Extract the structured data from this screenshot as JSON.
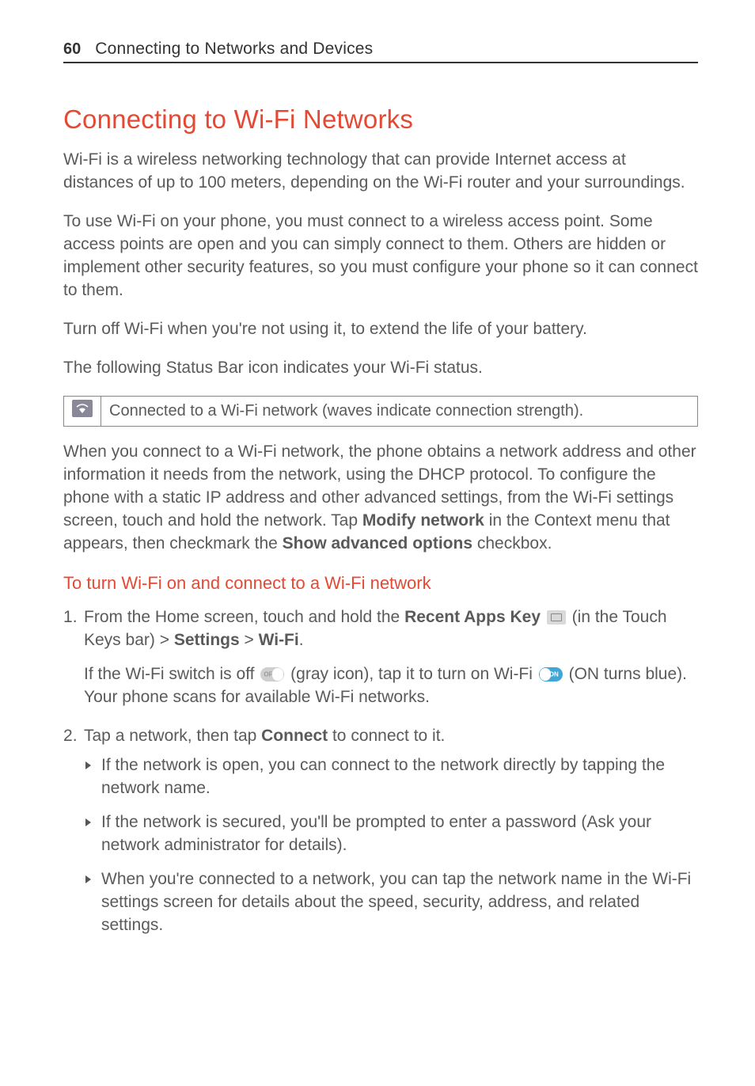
{
  "header": {
    "page_number": "60",
    "section": "Connecting to Networks and Devices"
  },
  "title": "Connecting to Wi-Fi Networks",
  "intro_paragraphs": [
    "Wi-Fi is a wireless networking technology that can provide Internet access at distances of up to 100 meters, depending on the Wi-Fi router and your surroundings.",
    "To use Wi-Fi on your phone, you must connect to a wireless access point. Some access points are open and you can simply connect to them. Others are hidden or implement other security features, so you must configure your phone so it can connect to them.",
    "Turn off Wi-Fi when you're not using it, to extend the life of your battery.",
    "The following Status Bar icon indicates your Wi-Fi status."
  ],
  "icon_table": {
    "icon_name": "wifi-connected-icon",
    "desc": "Connected to a Wi-Fi network (waves indicate connection strength)."
  },
  "dhcp_para": {
    "pre": "When you connect to a Wi-Fi network, the phone obtains a network address and other information it needs from the network, using the DHCP protocol. To configure the phone with a static IP address and other advanced settings, from the Wi-Fi settings screen, touch and hold the network. Tap ",
    "bold1": "Modify network",
    "mid": " in the Context menu that appears, then checkmark the ",
    "bold2": "Show advanced options",
    "post": " checkbox."
  },
  "subheading": "To turn Wi-Fi on and connect to a Wi-Fi network",
  "step1": {
    "line1_pre": "From the Home screen, touch and hold the ",
    "recent_apps": "Recent Apps Key",
    "line1_mid": " (in the Touch Keys bar) > ",
    "settings": "Settings",
    "gt": " > ",
    "wifi": "Wi-Fi",
    "period": ".",
    "line2_pre": "If the Wi-Fi switch is off ",
    "gray_icon_label": "OFF",
    "line2_mid": " (gray icon), tap it to turn on Wi-Fi ",
    "on_icon_label": "ON",
    "line2_post": " (ON turns blue). Your phone scans for available Wi-Fi networks."
  },
  "step2": {
    "line_pre": "Tap a network, then tap ",
    "connect": "Connect",
    "line_post": " to connect to it.",
    "bullets": [
      "If the network is open, you can connect to the network directly by tapping the network name.",
      "If the network is secured, you'll be prompted to enter a password (Ask your network administrator for details).",
      "When you're connected to a network, you can tap the network name in the Wi-Fi settings screen for details about the speed, security, address, and related settings."
    ]
  }
}
